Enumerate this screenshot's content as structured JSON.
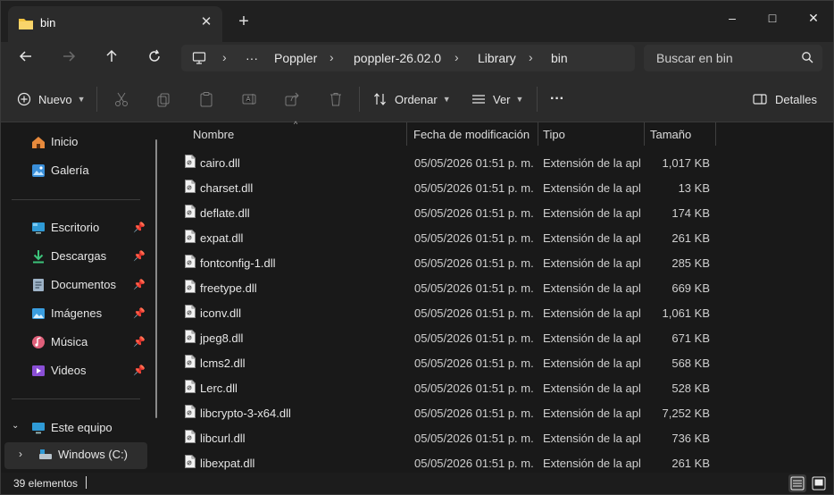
{
  "window": {
    "tab_title": "bin",
    "icons": {
      "folder": "folder-icon",
      "close": "close-icon",
      "new_tab": "plus-icon"
    },
    "controls": {
      "minimize": "–",
      "maximize": "□",
      "close": "✕"
    }
  },
  "nav": {
    "breadcrumbs": [
      "Poppler",
      "poppler-26.02.0",
      "Library",
      "bin"
    ],
    "overflow": "···",
    "search_placeholder": "Buscar en bin"
  },
  "commandbar": {
    "new_label": "Nuevo",
    "sort_label": "Ordenar",
    "view_label": "Ver",
    "more_label": "···",
    "details_label": "Detalles"
  },
  "sidebar": {
    "quick": [
      {
        "label": "Inicio",
        "icon": "home-icon"
      },
      {
        "label": "Galería",
        "icon": "gallery-icon"
      }
    ],
    "pinned": [
      {
        "label": "Escritorio",
        "icon": "desktop-icon"
      },
      {
        "label": "Descargas",
        "icon": "download-icon"
      },
      {
        "label": "Documentos",
        "icon": "documents-icon"
      },
      {
        "label": "Imágenes",
        "icon": "pictures-icon"
      },
      {
        "label": "Música",
        "icon": "music-icon"
      },
      {
        "label": "Videos",
        "icon": "videos-icon"
      }
    ],
    "this_pc": "Este equipo",
    "drive": "Windows  (C:)"
  },
  "columns": {
    "name": "Nombre",
    "modified": "Fecha de modificación",
    "type": "Tipo",
    "size": "Tamaño"
  },
  "files": [
    {
      "name": "cairo.dll",
      "modified": "05/05/2026 01:51 p. m.",
      "type": "Extensión de la apl...",
      "size": "1,017 KB"
    },
    {
      "name": "charset.dll",
      "modified": "05/05/2026 01:51 p. m.",
      "type": "Extensión de la apl...",
      "size": "13 KB"
    },
    {
      "name": "deflate.dll",
      "modified": "05/05/2026 01:51 p. m.",
      "type": "Extensión de la apl...",
      "size": "174 KB"
    },
    {
      "name": "expat.dll",
      "modified": "05/05/2026 01:51 p. m.",
      "type": "Extensión de la apl...",
      "size": "261 KB"
    },
    {
      "name": "fontconfig-1.dll",
      "modified": "05/05/2026 01:51 p. m.",
      "type": "Extensión de la apl...",
      "size": "285 KB"
    },
    {
      "name": "freetype.dll",
      "modified": "05/05/2026 01:51 p. m.",
      "type": "Extensión de la apl...",
      "size": "669 KB"
    },
    {
      "name": "iconv.dll",
      "modified": "05/05/2026 01:51 p. m.",
      "type": "Extensión de la apl...",
      "size": "1,061 KB"
    },
    {
      "name": "jpeg8.dll",
      "modified": "05/05/2026 01:51 p. m.",
      "type": "Extensión de la apl...",
      "size": "671 KB"
    },
    {
      "name": "lcms2.dll",
      "modified": "05/05/2026 01:51 p. m.",
      "type": "Extensión de la apl...",
      "size": "568 KB"
    },
    {
      "name": "Lerc.dll",
      "modified": "05/05/2026 01:51 p. m.",
      "type": "Extensión de la apl...",
      "size": "528 KB"
    },
    {
      "name": "libcrypto-3-x64.dll",
      "modified": "05/05/2026 01:51 p. m.",
      "type": "Extensión de la apl...",
      "size": "7,252 KB"
    },
    {
      "name": "libcurl.dll",
      "modified": "05/05/2026 01:51 p. m.",
      "type": "Extensión de la apl...",
      "size": "736 KB"
    },
    {
      "name": "libexpat.dll",
      "modified": "05/05/2026 01:51 p. m.",
      "type": "Extensión de la apl...",
      "size": "261 KB"
    }
  ],
  "status": {
    "count": "39 elementos"
  },
  "colors": {
    "bg": "#191919",
    "bar": "#2b2b2b",
    "accent_folder": "#f4c542"
  }
}
